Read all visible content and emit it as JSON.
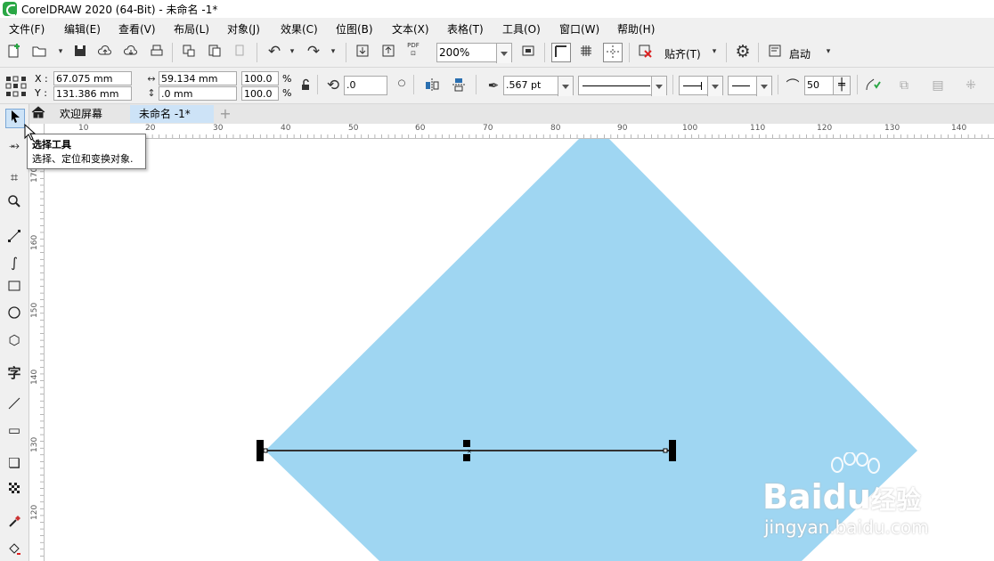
{
  "window": {
    "title": "CorelDRAW 2020 (64-Bit) - 未命名 -1*"
  },
  "menu": [
    "文件(F)",
    "编辑(E)",
    "查看(V)",
    "布局(L)",
    "对象(J)",
    "效果(C)",
    "位图(B)",
    "文本(X)",
    "表格(T)",
    "工具(O)",
    "窗口(W)",
    "帮助(H)"
  ],
  "toolbar": {
    "zoom": "200%",
    "snap_label": "贴齐(T)",
    "launch_label": "启动",
    "pdf_label": "PDF"
  },
  "property_bar": {
    "x_label": "X :",
    "y_label": "Y :",
    "x_value": "67.075 mm",
    "y_value": "131.386 mm",
    "width_value": "59.134 mm",
    "height_value": ".0 mm",
    "scale_x": "100.0",
    "scale_y": "100.0",
    "percent": "%",
    "rotation": ".0",
    "outline_width": ".567 pt",
    "smoothing": "50"
  },
  "tabs": {
    "welcome": "欢迎屏幕",
    "document": "未命名 -1*"
  },
  "ruler": {
    "h_ticks": [
      "10",
      "20",
      "30",
      "40",
      "50",
      "60",
      "70",
      "80",
      "90",
      "100",
      "110",
      "120",
      "130",
      "140"
    ],
    "v_ticks": [
      "170",
      "160",
      "150",
      "140",
      "130",
      "120"
    ]
  },
  "tooltip": {
    "title": "选择工具",
    "description": "选择、定位和变换对象."
  },
  "watermark": {
    "brand": "Baidu",
    "brand_cn": "经验",
    "url": "jingyan.baidu.com"
  },
  "colors": {
    "shape_fill": "#9fd6f2",
    "selection_handle": "#000000",
    "accent": "#2aa745"
  },
  "icons": [
    "new-file-icon",
    "open-icon",
    "save-icon",
    "cloud-upload-icon",
    "print-icon",
    "undo-icon",
    "redo-icon",
    "import-icon",
    "export-icon",
    "full-screen-icon",
    "settings-icon",
    "pick-tool-icon",
    "shape-tool-icon",
    "crop-tool-icon",
    "zoom-tool-icon",
    "freehand-tool-icon",
    "bezier-tool-icon",
    "rectangle-tool-icon",
    "ellipse-tool-icon",
    "polygon-tool-icon",
    "text-tool-icon",
    "connector-tool-icon",
    "interactive-tool-icon",
    "drop-shadow-icon",
    "transparency-icon",
    "eyedropper-icon",
    "fill-icon"
  ]
}
